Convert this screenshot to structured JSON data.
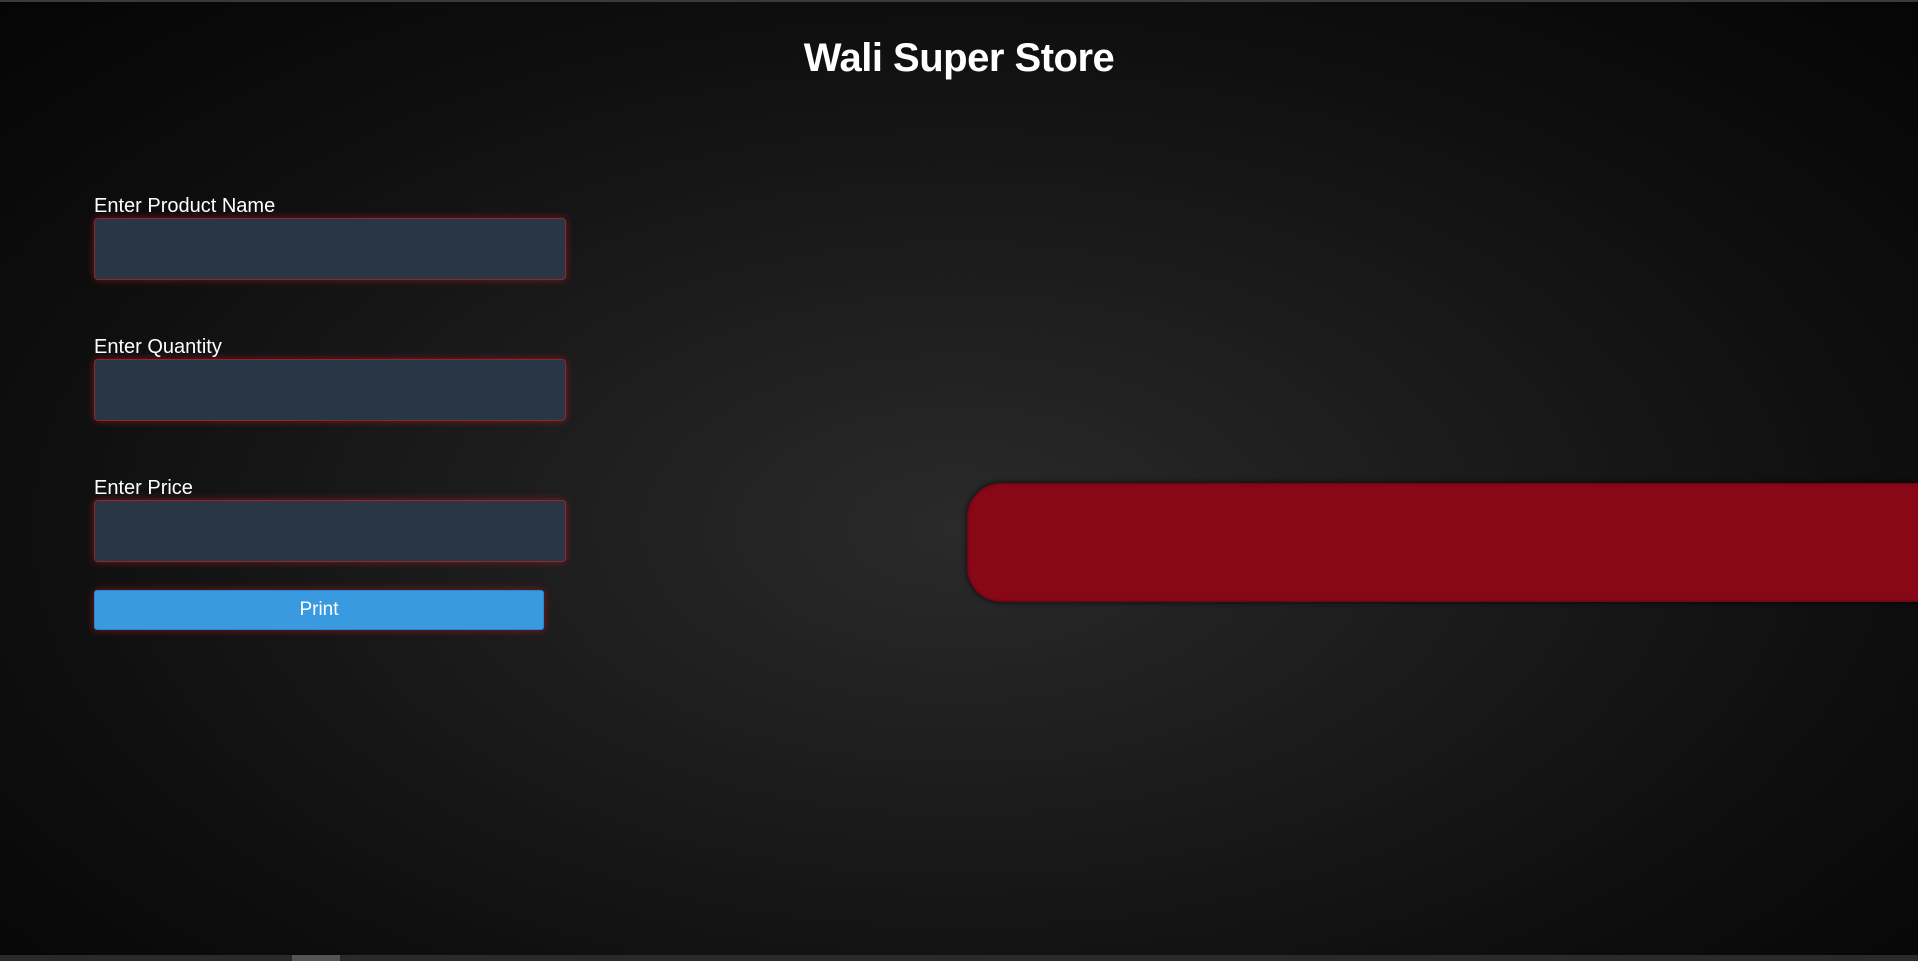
{
  "header": {
    "title": "Wali Super Store"
  },
  "form": {
    "fields": [
      {
        "label": "Enter Product Name",
        "value": "",
        "placeholder": ""
      },
      {
        "label": "Enter Quantity",
        "value": "",
        "placeholder": ""
      },
      {
        "label": "Enter Price",
        "value": "",
        "placeholder": ""
      }
    ],
    "print_label": "Print"
  },
  "output": {
    "text": ""
  },
  "colors": {
    "input_background": "#283646",
    "input_glow": "#c81e28",
    "button_background": "#3a9ae0",
    "output_panel": "#880818"
  }
}
